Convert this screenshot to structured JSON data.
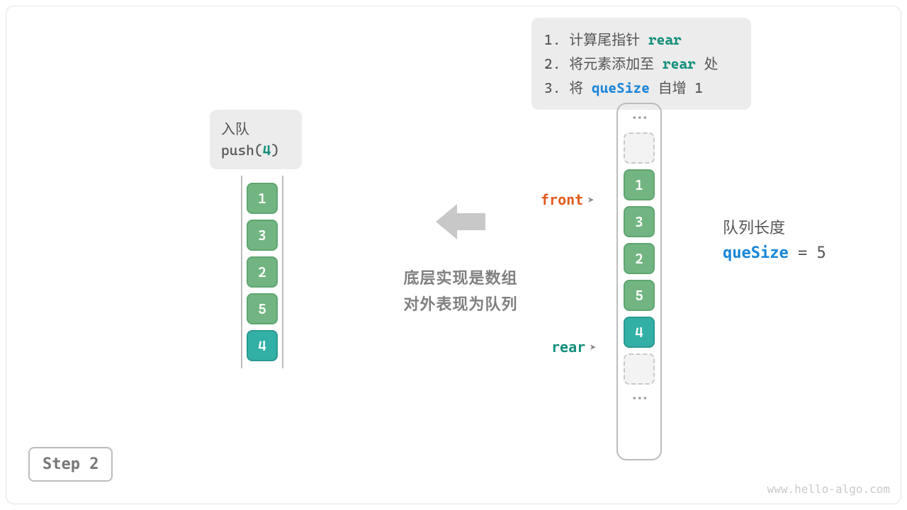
{
  "info_box": {
    "line1_pre": "1. 计算尾指针 ",
    "line1_kw": "rear",
    "line2_pre": "2. 将元素添加至 ",
    "line2_kw": "rear",
    "line2_post": " 处",
    "line3_pre": "3. 将 ",
    "line3_kw": "queSize",
    "line3_post": " 自增 1"
  },
  "enqueue": {
    "title": "入队",
    "call_pre": "push(",
    "arg": "4",
    "call_post": ")"
  },
  "queue": {
    "items": [
      {
        "value": "1",
        "color": "green"
      },
      {
        "value": "3",
        "color": "green"
      },
      {
        "value": "2",
        "color": "green"
      },
      {
        "value": "5",
        "color": "green"
      },
      {
        "value": "4",
        "color": "teal"
      }
    ]
  },
  "caption": {
    "line1": "底层实现是数组",
    "line2": "对外表现为队列"
  },
  "array": {
    "slots": [
      {
        "type": "vdots"
      },
      {
        "type": "empty"
      },
      {
        "type": "value",
        "value": "1",
        "color": "green"
      },
      {
        "type": "value",
        "value": "3",
        "color": "green"
      },
      {
        "type": "value",
        "value": "2",
        "color": "green"
      },
      {
        "type": "value",
        "value": "5",
        "color": "green"
      },
      {
        "type": "value",
        "value": "4",
        "color": "teal"
      },
      {
        "type": "empty"
      },
      {
        "type": "vdots"
      }
    ]
  },
  "pointers": {
    "front_label": "front",
    "rear_label": "rear",
    "arrow": "➤"
  },
  "qsize": {
    "title": "队列长度",
    "kw": "queSize",
    "eq": " = ",
    "value": "5"
  },
  "step": "Step 2",
  "watermark": "www.hello-algo.com",
  "colors": {
    "green": "#72b582",
    "teal": "#33b0a6",
    "front": "#e15a1d",
    "rear": "#138f7b",
    "quesize": "#1985d8"
  }
}
